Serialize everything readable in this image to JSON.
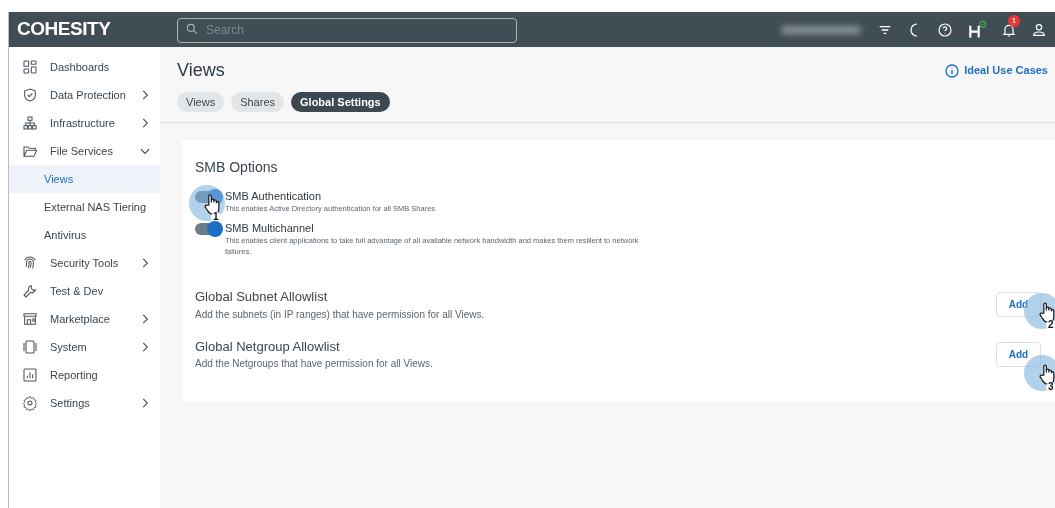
{
  "header": {
    "logo": "COHESITY",
    "search": {
      "placeholder": "Search"
    },
    "notifications": {
      "count": "1"
    }
  },
  "sidebar": {
    "items": [
      {
        "label": "Dashboards",
        "selected": false
      },
      {
        "label": "Data Protection",
        "selected": false,
        "expanded": false
      },
      {
        "label": "Infrastructure",
        "selected": false,
        "expanded": false
      },
      {
        "label": "File Services",
        "selected": false,
        "expanded": true,
        "children": [
          {
            "label": "Views",
            "selected": true
          },
          {
            "label": "External NAS Tiering",
            "selected": false
          },
          {
            "label": "Antivirus",
            "selected": false
          }
        ]
      },
      {
        "label": "Security Tools",
        "selected": false,
        "expanded": false
      },
      {
        "label": "Test & Dev",
        "selected": false
      },
      {
        "label": "Marketplace",
        "selected": false,
        "expanded": false
      },
      {
        "label": "System",
        "selected": false,
        "expanded": false
      },
      {
        "label": "Reporting",
        "selected": false
      },
      {
        "label": "Settings",
        "selected": false,
        "expanded": false
      }
    ]
  },
  "page": {
    "title": "Views",
    "help_link": "Ideal Use Cases",
    "tabs": [
      {
        "label": "Views",
        "selected": false
      },
      {
        "label": "Shares",
        "selected": false
      },
      {
        "label": "Global Settings",
        "selected": true
      }
    ]
  },
  "smb_options": {
    "title": "SMB Options",
    "toggles": [
      {
        "label": "SMB Authentication",
        "description": "This enables Active Directory authentication for all SMB Shares",
        "on": true,
        "callout": "1"
      },
      {
        "label": "SMB Multichannel",
        "description": "This enables client applications to take full advantage of all available network bandwidth and makes them resilient to network failures.",
        "on": true
      }
    ]
  },
  "allowlists": [
    {
      "title": "Global Subnet Allowlist",
      "description": "Add the subnets (in IP ranges) that have permission for all Views.",
      "button": "Add",
      "callout": "2"
    },
    {
      "title": "Global Netgroup Allowlist",
      "description": "Add the Netgroups that have permission for all Views.",
      "button": "Add",
      "callout": "3"
    }
  ]
}
